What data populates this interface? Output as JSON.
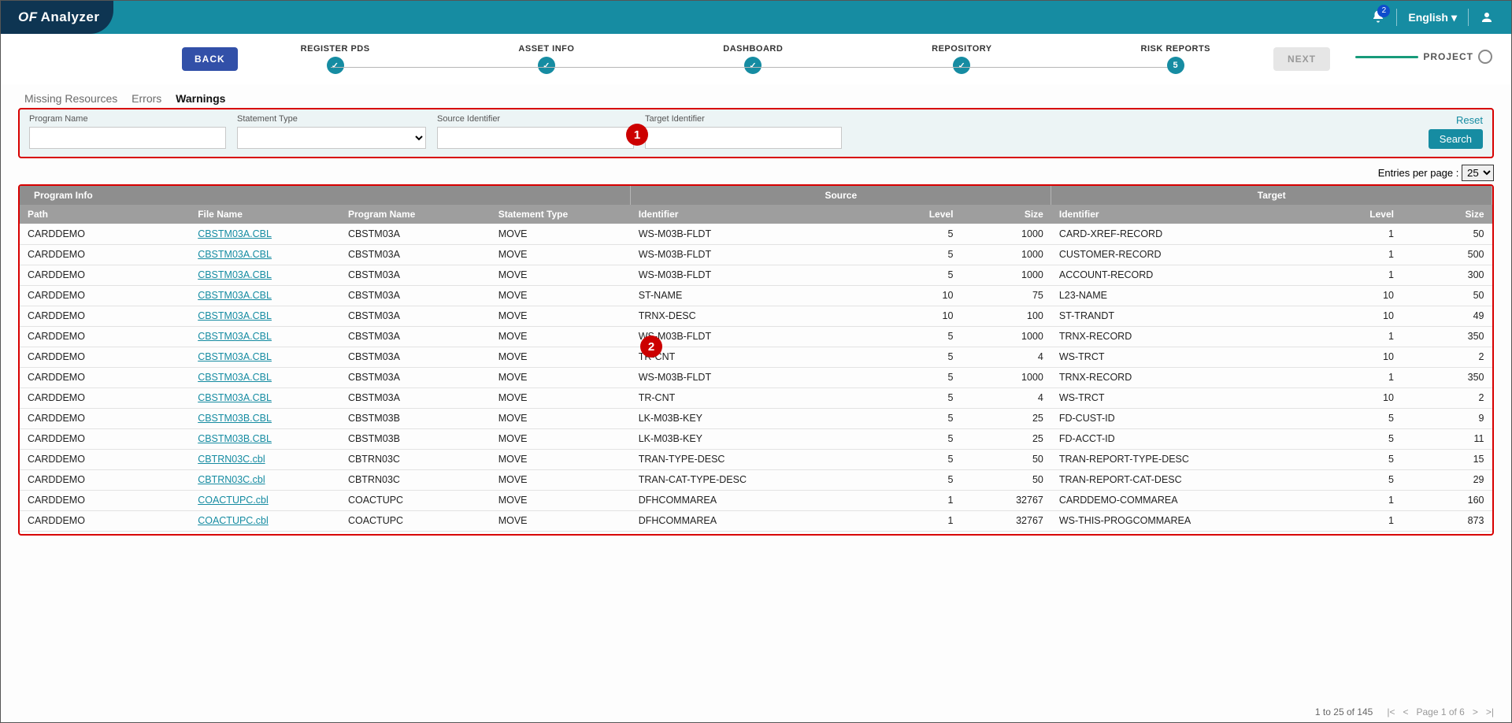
{
  "header": {
    "logo_prefix": "OF",
    "logo_rest": "Analyzer",
    "notif_count": "2",
    "language_label": "English"
  },
  "stepper": {
    "back": "BACK",
    "next": "NEXT",
    "project_label": "PROJECT",
    "steps": [
      {
        "label": "REGISTER PDS",
        "badge": "✓"
      },
      {
        "label": "ASSET INFO",
        "badge": "✓"
      },
      {
        "label": "DASHBOARD",
        "badge": "✓"
      },
      {
        "label": "REPOSITORY",
        "badge": "✓"
      },
      {
        "label": "RISK REPORTS",
        "badge": "5"
      }
    ]
  },
  "tabs": {
    "items": [
      "Missing Resources",
      "Errors",
      "Warnings"
    ],
    "active_index": 2
  },
  "filters": {
    "program_name_label": "Program Name",
    "statement_type_label": "Statement Type",
    "source_identifier_label": "Source Identifier",
    "target_identifier_label": "Target Identifier",
    "reset": "Reset",
    "search": "Search"
  },
  "callouts": {
    "c1": "1",
    "c2": "2"
  },
  "entries_per_page_label": "Entries per page :",
  "entries_per_page_value": "25",
  "table": {
    "group_headers": [
      "Program Info",
      "Source",
      "Target"
    ],
    "columns": [
      "Path",
      "File Name",
      "Program Name",
      "Statement Type",
      "Identifier",
      "Level",
      "Size",
      "Identifier",
      "Level",
      "Size"
    ],
    "rows": [
      {
        "path": "CARDDEMO",
        "file": "CBSTM03A.CBL",
        "prog": "CBSTM03A",
        "stype": "MOVE",
        "sid": "WS-M03B-FLDT",
        "slvl": "5",
        "ssize": "1000",
        "tid": "CARD-XREF-RECORD",
        "tlvl": "1",
        "tsize": "50"
      },
      {
        "path": "CARDDEMO",
        "file": "CBSTM03A.CBL",
        "prog": "CBSTM03A",
        "stype": "MOVE",
        "sid": "WS-M03B-FLDT",
        "slvl": "5",
        "ssize": "1000",
        "tid": "CUSTOMER-RECORD",
        "tlvl": "1",
        "tsize": "500"
      },
      {
        "path": "CARDDEMO",
        "file": "CBSTM03A.CBL",
        "prog": "CBSTM03A",
        "stype": "MOVE",
        "sid": "WS-M03B-FLDT",
        "slvl": "5",
        "ssize": "1000",
        "tid": "ACCOUNT-RECORD",
        "tlvl": "1",
        "tsize": "300"
      },
      {
        "path": "CARDDEMO",
        "file": "CBSTM03A.CBL",
        "prog": "CBSTM03A",
        "stype": "MOVE",
        "sid": "ST-NAME",
        "slvl": "10",
        "ssize": "75",
        "tid": "L23-NAME",
        "tlvl": "10",
        "tsize": "50"
      },
      {
        "path": "CARDDEMO",
        "file": "CBSTM03A.CBL",
        "prog": "CBSTM03A",
        "stype": "MOVE",
        "sid": "TRNX-DESC",
        "slvl": "10",
        "ssize": "100",
        "tid": "ST-TRANDT",
        "tlvl": "10",
        "tsize": "49"
      },
      {
        "path": "CARDDEMO",
        "file": "CBSTM03A.CBL",
        "prog": "CBSTM03A",
        "stype": "MOVE",
        "sid": "WS-M03B-FLDT",
        "slvl": "5",
        "ssize": "1000",
        "tid": "TRNX-RECORD",
        "tlvl": "1",
        "tsize": "350"
      },
      {
        "path": "CARDDEMO",
        "file": "CBSTM03A.CBL",
        "prog": "CBSTM03A",
        "stype": "MOVE",
        "sid": "TR-CNT",
        "slvl": "5",
        "ssize": "4",
        "tid": "WS-TRCT",
        "tlvl": "10",
        "tsize": "2"
      },
      {
        "path": "CARDDEMO",
        "file": "CBSTM03A.CBL",
        "prog": "CBSTM03A",
        "stype": "MOVE",
        "sid": "WS-M03B-FLDT",
        "slvl": "5",
        "ssize": "1000",
        "tid": "TRNX-RECORD",
        "tlvl": "1",
        "tsize": "350"
      },
      {
        "path": "CARDDEMO",
        "file": "CBSTM03A.CBL",
        "prog": "CBSTM03A",
        "stype": "MOVE",
        "sid": "TR-CNT",
        "slvl": "5",
        "ssize": "4",
        "tid": "WS-TRCT",
        "tlvl": "10",
        "tsize": "2"
      },
      {
        "path": "CARDDEMO",
        "file": "CBSTM03B.CBL",
        "prog": "CBSTM03B",
        "stype": "MOVE",
        "sid": "LK-M03B-KEY",
        "slvl": "5",
        "ssize": "25",
        "tid": "FD-CUST-ID",
        "tlvl": "5",
        "tsize": "9"
      },
      {
        "path": "CARDDEMO",
        "file": "CBSTM03B.CBL",
        "prog": "CBSTM03B",
        "stype": "MOVE",
        "sid": "LK-M03B-KEY",
        "slvl": "5",
        "ssize": "25",
        "tid": "FD-ACCT-ID",
        "tlvl": "5",
        "tsize": "11"
      },
      {
        "path": "CARDDEMO",
        "file": "CBTRN03C.cbl",
        "prog": "CBTRN03C",
        "stype": "MOVE",
        "sid": "TRAN-TYPE-DESC",
        "slvl": "5",
        "ssize": "50",
        "tid": "TRAN-REPORT-TYPE-DESC",
        "tlvl": "5",
        "tsize": "15"
      },
      {
        "path": "CARDDEMO",
        "file": "CBTRN03C.cbl",
        "prog": "CBTRN03C",
        "stype": "MOVE",
        "sid": "TRAN-CAT-TYPE-DESC",
        "slvl": "5",
        "ssize": "50",
        "tid": "TRAN-REPORT-CAT-DESC",
        "tlvl": "5",
        "tsize": "29"
      },
      {
        "path": "CARDDEMO",
        "file": "COACTUPC.cbl",
        "prog": "COACTUPC",
        "stype": "MOVE",
        "sid": "DFHCOMMAREA",
        "slvl": "1",
        "ssize": "32767",
        "tid": "CARDDEMO-COMMAREA",
        "tlvl": "1",
        "tsize": "160"
      },
      {
        "path": "CARDDEMO",
        "file": "COACTUPC.cbl",
        "prog": "COACTUPC",
        "stype": "MOVE",
        "sid": "DFHCOMMAREA",
        "slvl": "1",
        "ssize": "32767",
        "tid": "WS-THIS-PROGCOMMAREA",
        "tlvl": "1",
        "tsize": "873"
      }
    ]
  },
  "pager": {
    "range": "1 to 25 of 145",
    "page": "Page 1 of 6"
  }
}
